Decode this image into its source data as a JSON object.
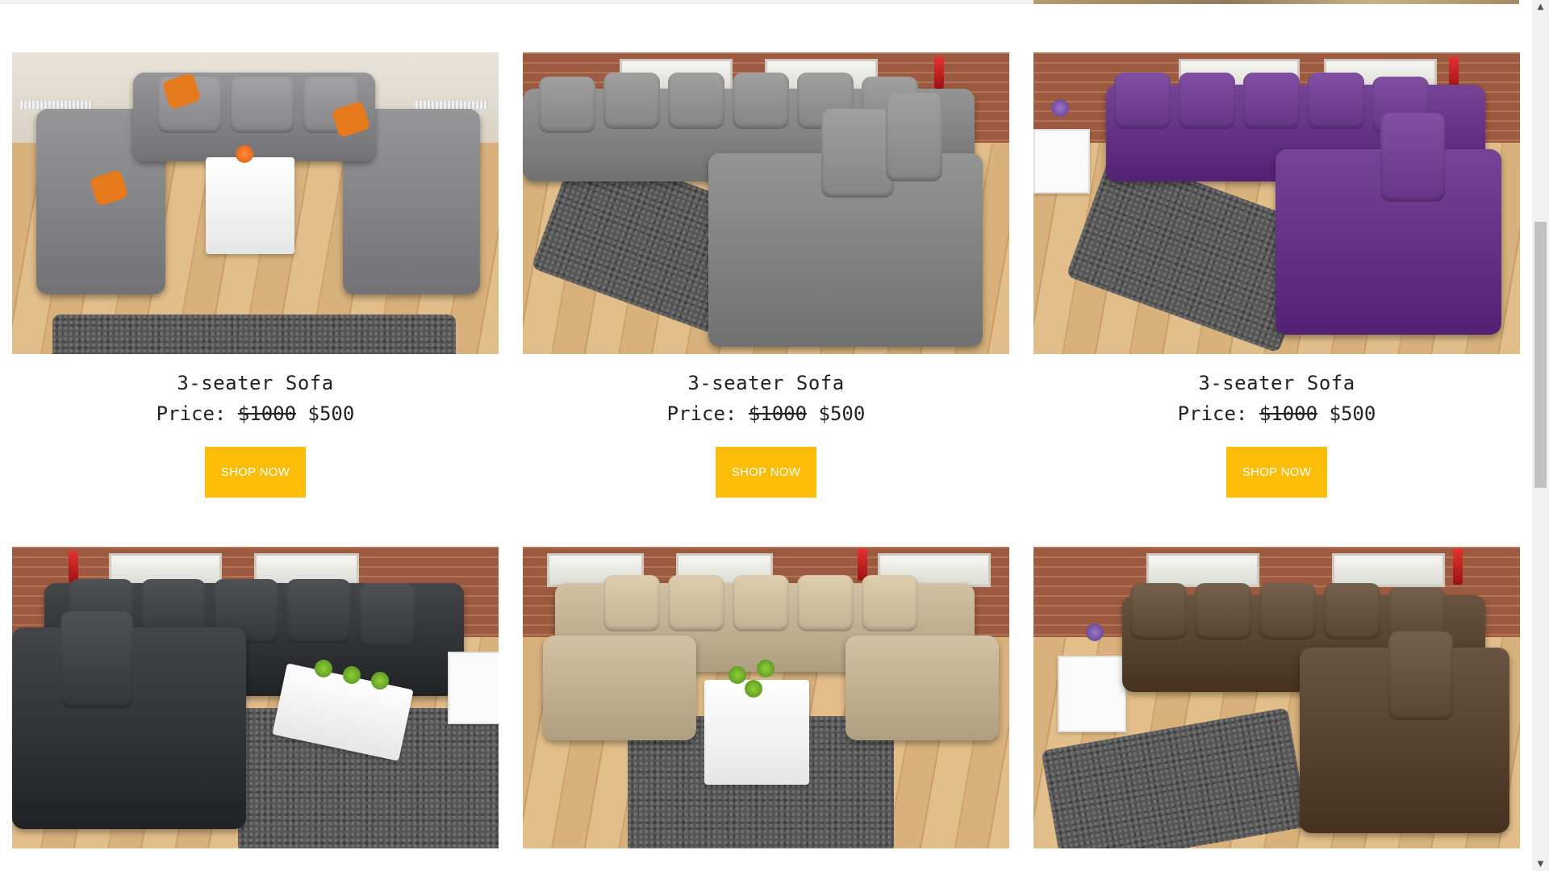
{
  "products": [
    {
      "title": "3-seater Sofa",
      "price_label": "Price:",
      "old_price": "$1000",
      "new_price": "$500",
      "button": "SHOP NOW",
      "sofa_color": "#8c8c8e"
    },
    {
      "title": "3-seater Sofa",
      "price_label": "Price:",
      "old_price": "$1000",
      "new_price": "$500",
      "button": "SHOP NOW",
      "sofa_color": "#8a8a8a"
    },
    {
      "title": "3-seater Sofa",
      "price_label": "Price:",
      "old_price": "$1000",
      "new_price": "$500",
      "button": "SHOP NOW",
      "sofa_color": "#6b3a8c"
    },
    {
      "title": "",
      "price_label": "",
      "old_price": "",
      "new_price": "",
      "button": "",
      "sofa_color": "#3a3b3f"
    },
    {
      "title": "",
      "price_label": "",
      "old_price": "",
      "new_price": "",
      "button": "",
      "sofa_color": "#c9b79a"
    },
    {
      "title": "",
      "price_label": "",
      "old_price": "",
      "new_price": "",
      "button": "",
      "sofa_color": "#5e4a36"
    }
  ],
  "colors": {
    "button_bg": "#fbbd07",
    "button_text": "#ffffff",
    "text": "#222222"
  },
  "scrollbar": {
    "up_icon": "▲",
    "down_icon": "▼"
  }
}
